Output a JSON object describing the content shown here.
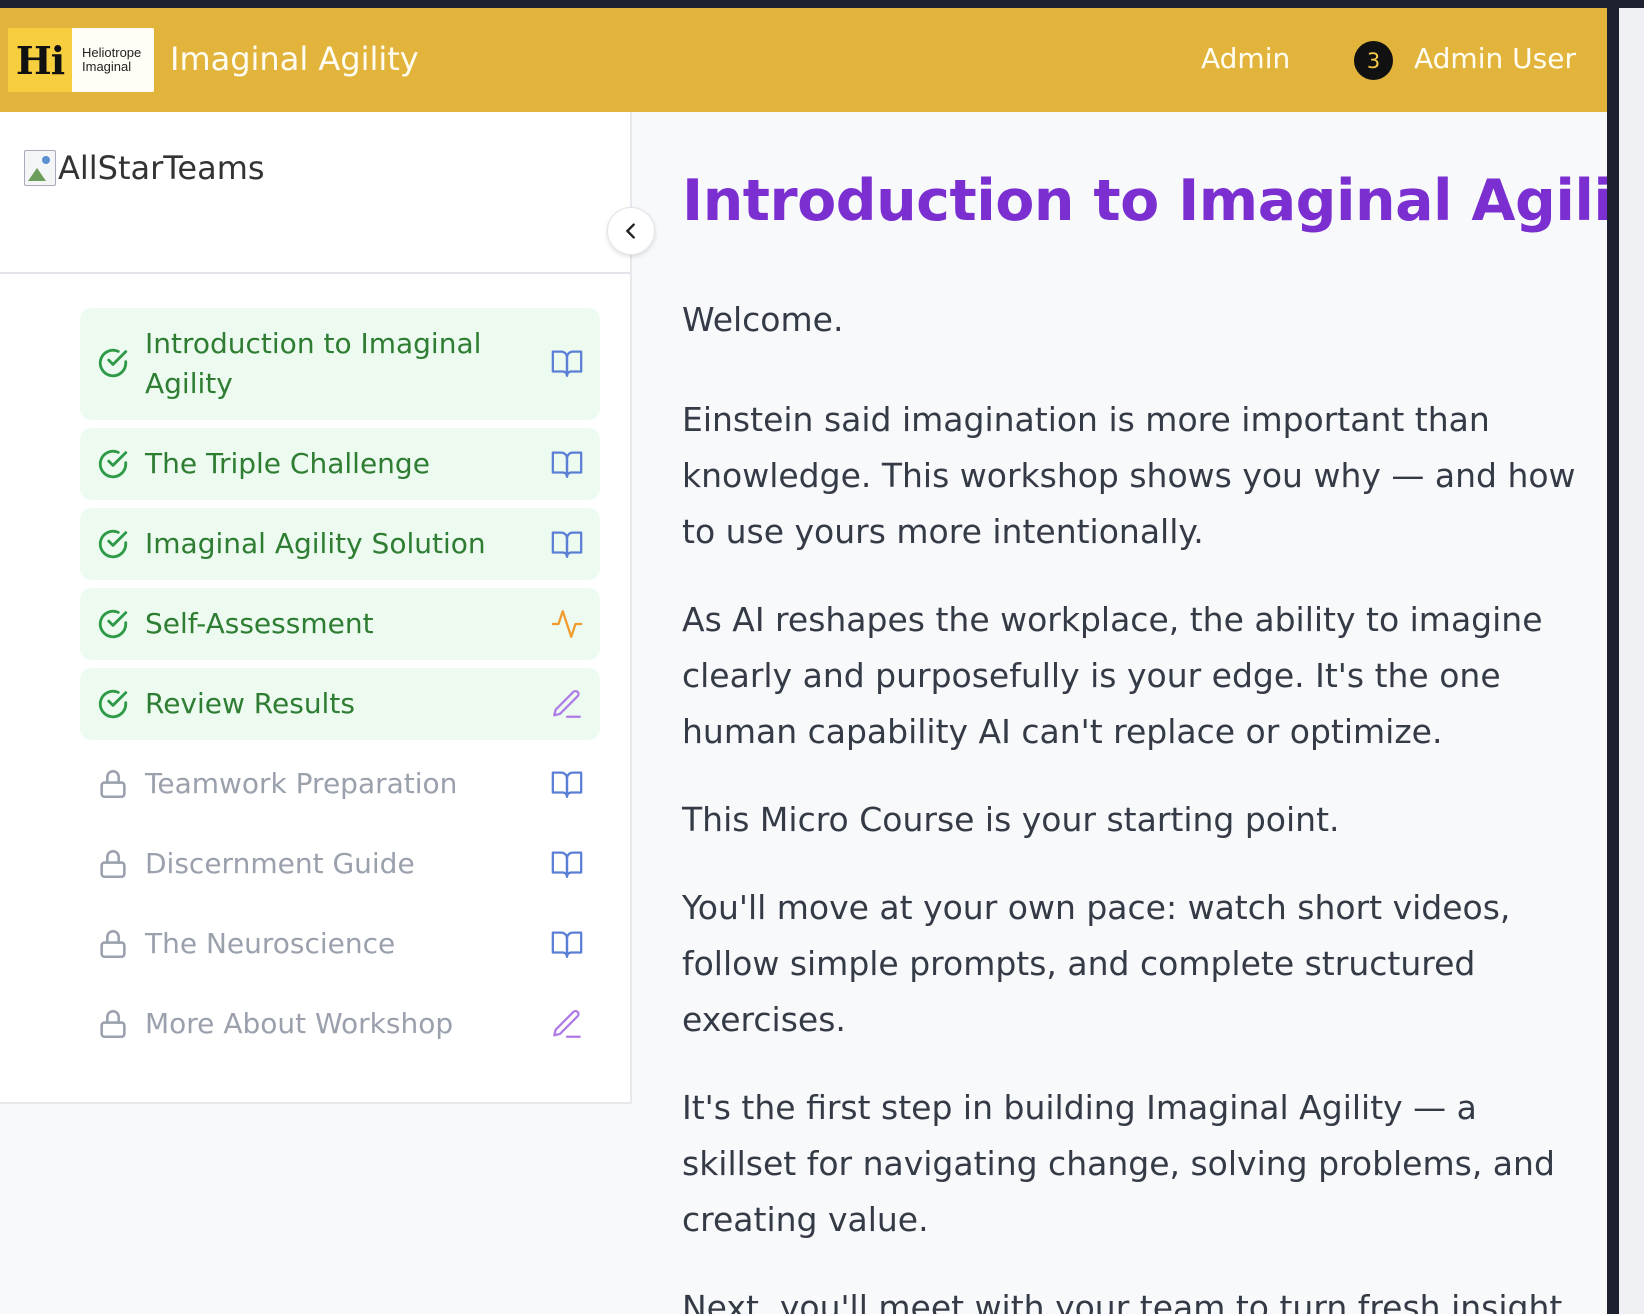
{
  "header": {
    "logo_mark": "Hi",
    "logo_line1": "Heliotrope",
    "logo_line2": "Imaginal",
    "app_title": "Imaginal Agility",
    "admin_link": "Admin",
    "user_badge": "3",
    "user_name": "Admin User"
  },
  "sidebar": {
    "logo_alt": "AllStarTeams",
    "items": [
      {
        "label": "Introduction to Imaginal Agility",
        "status": "complete",
        "type_icon": "book-icon"
      },
      {
        "label": "The Triple Challenge",
        "status": "complete",
        "type_icon": "book-icon"
      },
      {
        "label": "Imaginal Agility Solution",
        "status": "complete",
        "type_icon": "book-icon"
      },
      {
        "label": "Self-Assessment",
        "status": "complete",
        "type_icon": "activity-icon"
      },
      {
        "label": "Review Results",
        "status": "complete",
        "type_icon": "pencil-icon"
      },
      {
        "label": "Teamwork Preparation",
        "status": "locked",
        "type_icon": "book-icon"
      },
      {
        "label": "Discernment Guide",
        "status": "locked",
        "type_icon": "book-icon"
      },
      {
        "label": "The Neuroscience",
        "status": "locked",
        "type_icon": "book-icon"
      },
      {
        "label": "More About Workshop",
        "status": "locked",
        "type_icon": "pencil-icon"
      }
    ]
  },
  "main": {
    "title": "Introduction to Imaginal Agility",
    "paragraphs": [
      "Welcome.",
      "Einstein said imagination is more important than knowledge. This workshop shows you why — and how to use yours more intentionally.",
      "As AI reshapes the workplace, the ability to imagine clearly and purposefully is your edge. It's the one human capability AI can't replace or optimize.",
      "This Micro Course is your starting point.",
      "You'll move at your own pace: watch short videos, follow simple prompts, and complete structured exercises.",
      "It's the first step in building Imaginal Agility — a skillset for navigating change, solving problems, and creating value.",
      "Next, you'll meet with your team to turn fresh insight"
    ]
  },
  "colors": {
    "header_bg": "#e2b43c",
    "title_purple": "#7b2fd0",
    "complete_green": "#2e7d32",
    "complete_bg": "#ecfaf0",
    "locked_gray": "#9aa1ad",
    "book_blue": "#5b7fd6",
    "activity_orange": "#f29a2e",
    "pencil_purple": "#b07ae6"
  }
}
